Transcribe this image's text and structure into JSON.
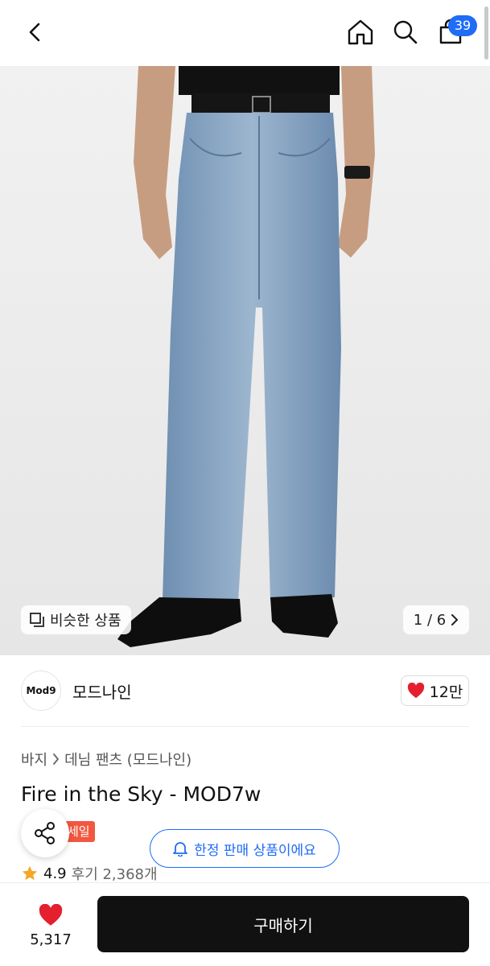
{
  "header": {
    "cart_count": "39",
    "icons": [
      "back-icon",
      "home-icon",
      "search-icon",
      "cart-icon"
    ]
  },
  "gallery": {
    "similar_label": "비슷한 상품",
    "pager_label": "1 / 6"
  },
  "brand": {
    "logo_text": "Mod9",
    "name": "모드나인",
    "likes": "12만"
  },
  "product": {
    "breadcrumb": [
      "바지",
      "데님 팬츠 (모드나인)"
    ],
    "title": "Fire in the Sky - MOD7w",
    "sale_tag": "세일",
    "limited_label": "한정 판매 상품이에요",
    "rating": "4.9",
    "reviews": "후기 2,368개"
  },
  "bottom_bar": {
    "wish_count": "5,317",
    "buy_label": "구매하기"
  },
  "colors": {
    "accent": "#1f6cf6",
    "heart": "#e5202e",
    "sale": "#f2573f",
    "buy_button": "#111111"
  }
}
